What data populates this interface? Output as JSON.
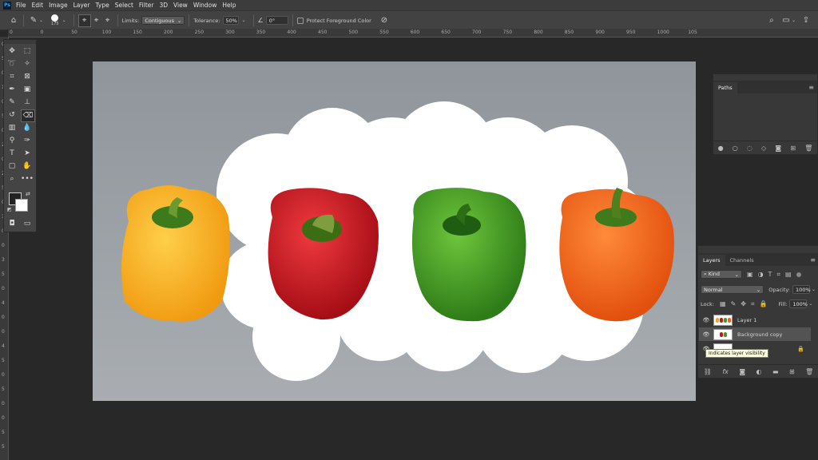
{
  "app": {
    "logo": "Ps"
  },
  "menu": [
    "File",
    "Edit",
    "Image",
    "Layer",
    "Type",
    "Select",
    "Filter",
    "3D",
    "View",
    "Window",
    "Help"
  ],
  "options": {
    "brush_size": "175",
    "limits_label": "Limits:",
    "limits_value": "Contiguous",
    "tolerance_label": "Tolerance:",
    "tolerance_value": "50%",
    "angle_value": "0°",
    "protect_label": "Protect Foreground Color"
  },
  "ruler": {
    "h_ticks": [
      "0",
      "0",
      "50",
      "100",
      "150",
      "200",
      "250",
      "300",
      "350",
      "400",
      "450",
      "500",
      "550",
      "600",
      "650",
      "700",
      "750",
      "800",
      "850",
      "900",
      "950",
      "1000",
      "105"
    ],
    "v_ticks": [
      "0",
      "5",
      "0",
      "1",
      "0",
      "5",
      "0",
      "2",
      "0",
      "2",
      "5",
      "0",
      "3",
      "0",
      "0",
      "3",
      "5",
      "0",
      "4",
      "0",
      "0",
      "4",
      "5",
      "0",
      "5",
      "0",
      "0",
      "5",
      "5"
    ]
  },
  "colors": {
    "canvas_bg": "#9aa0a5",
    "yellow_pepper": "#f5a623",
    "red_pepper": "#c8141e",
    "green_pepper": "#3f9c22",
    "orange_pepper": "#f2661b"
  },
  "paths_panel": {
    "tab": "Paths"
  },
  "layers_panel": {
    "tabs": [
      "Layers",
      "Channels"
    ],
    "kind_label": "Kind",
    "blend_mode": "Normal",
    "opacity_label": "Opacity:",
    "opacity_value": "100%",
    "lock_label": "Lock:",
    "fill_label": "Fill:",
    "fill_value": "100%",
    "layers": [
      {
        "name": "Layer 1"
      },
      {
        "name": "Background copy"
      }
    ],
    "tooltip": "Indicates layer visibility"
  }
}
